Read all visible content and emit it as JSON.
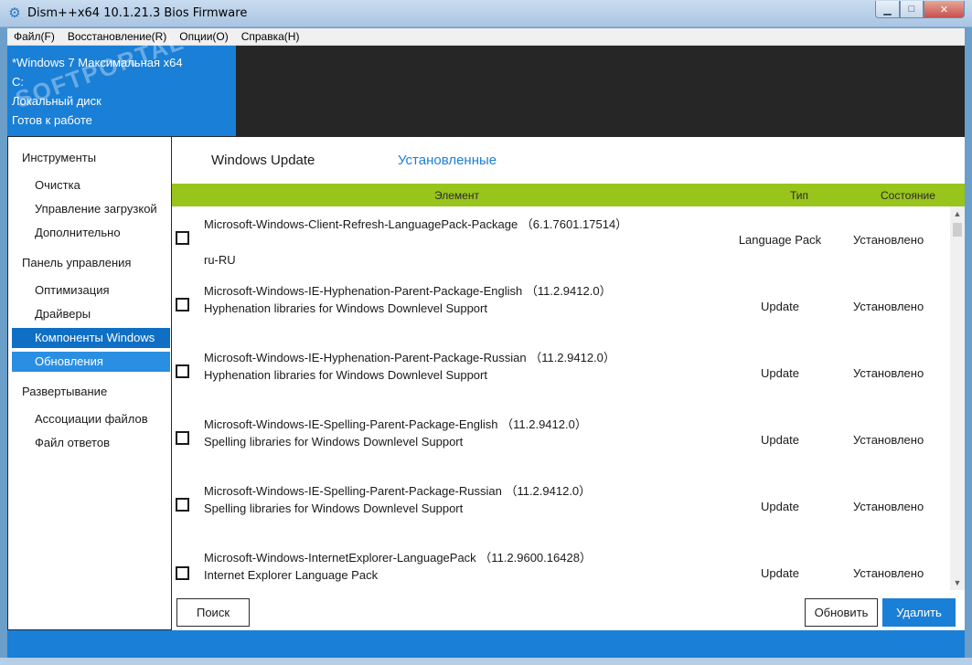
{
  "window": {
    "title": "Dism++x64 10.1.21.3 Bios Firmware",
    "icon": "gear-icon",
    "controls": {
      "minimize": "▁",
      "maximize": "□",
      "close": "✕"
    }
  },
  "menubar": {
    "items": [
      "Файл(F)",
      "Восстановление(R)",
      "Опции(O)",
      "Справка(H)"
    ]
  },
  "system_info": {
    "os": "*Windows 7 Максимальная x64",
    "drive": "C:",
    "disk_type": "Локальный диск",
    "status": "Готов к работе",
    "watermark": "SOFTPORTAL"
  },
  "sidebar": {
    "groups": [
      {
        "label": "Инструменты",
        "items": [
          "Очистка",
          "Управление загрузкой",
          "Дополнительно"
        ]
      },
      {
        "label": "Панель управления",
        "items": [
          "Оптимизация",
          "Драйверы",
          "Компоненты Windows",
          "Обновления"
        ]
      },
      {
        "label": "Развертывание",
        "items": [
          "Ассоциации файлов",
          "Файл ответов"
        ]
      }
    ]
  },
  "tabs": {
    "windows_update": "Windows Update",
    "installed": "Установленные"
  },
  "table": {
    "headers": {
      "element": "Элемент",
      "type": "Тип",
      "state": "Состояние"
    },
    "rows": [
      {
        "name": "Microsoft-Windows-Client-Refresh-LanguagePack-Package （6.1.7601.17514）",
        "desc": "ru-RU",
        "type": "Language Pack",
        "state": "Установлено"
      },
      {
        "name": "Microsoft-Windows-IE-Hyphenation-Parent-Package-English （11.2.9412.0）",
        "desc": "Hyphenation libraries for Windows Downlevel Support",
        "type": "Update",
        "state": "Установлено"
      },
      {
        "name": "Microsoft-Windows-IE-Hyphenation-Parent-Package-Russian （11.2.9412.0）",
        "desc": "Hyphenation libraries for Windows Downlevel Support",
        "type": "Update",
        "state": "Установлено"
      },
      {
        "name": "Microsoft-Windows-IE-Spelling-Parent-Package-English （11.2.9412.0）",
        "desc": "Spelling libraries for Windows Downlevel Support",
        "type": "Update",
        "state": "Установлено"
      },
      {
        "name": "Microsoft-Windows-IE-Spelling-Parent-Package-Russian （11.2.9412.0）",
        "desc": "Spelling libraries for Windows Downlevel Support",
        "type": "Update",
        "state": "Установлено"
      },
      {
        "name": "Microsoft-Windows-InternetExplorer-LanguagePack （11.2.9600.16428）",
        "desc": "Internet Explorer Language Pack",
        "type": "Update",
        "state": "Установлено"
      }
    ]
  },
  "buttons": {
    "search": "Поиск",
    "refresh": "Обновить",
    "delete": "Удалить"
  },
  "colors": {
    "accent": "#1a7fd6",
    "header_green": "#98c41c",
    "dark_panel": "#262626"
  }
}
